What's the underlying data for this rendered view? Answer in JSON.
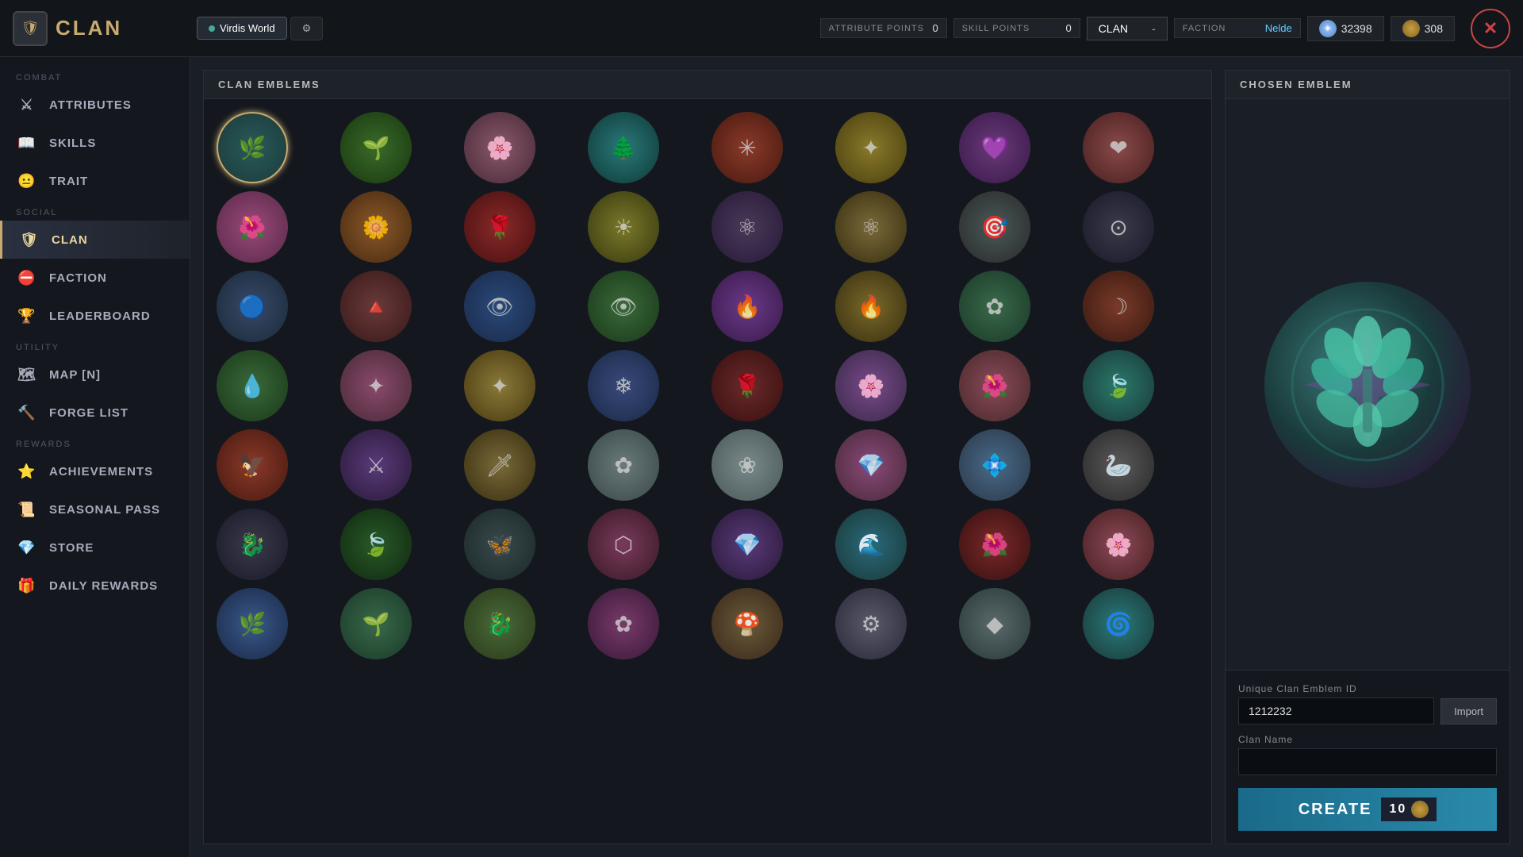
{
  "topbar": {
    "logo": "CLAN",
    "tabs": [
      {
        "label": "Virdis World",
        "active": true
      },
      {
        "label": "⚙",
        "active": false
      }
    ],
    "attribute_points_label": "ATTRIBUTE POINTS",
    "attribute_points_value": "0",
    "skill_points_label": "SKILL POINTS",
    "skill_points_value": "0",
    "clan_label": "CLAN",
    "clan_dash": "-",
    "faction_label": "FACTION",
    "faction_value": "Nelde",
    "currency1_value": "32398",
    "currency2_value": "308",
    "close_label": "✕"
  },
  "sidebar": {
    "section_combat": "COMBAT",
    "section_social": "SOCIAL",
    "section_utility": "UTILITY",
    "section_rewards": "REWARDS",
    "items": [
      {
        "id": "attributes",
        "label": "ATTRIBUTES",
        "icon": "⚔",
        "section": "combat"
      },
      {
        "id": "skills",
        "label": "SKILLS",
        "icon": "📖",
        "section": "combat"
      },
      {
        "id": "trait",
        "label": "TRAIT",
        "icon": "😐",
        "section": "combat"
      },
      {
        "id": "clan",
        "label": "CLAN",
        "icon": "🛡",
        "section": "social",
        "active": true
      },
      {
        "id": "faction",
        "label": "FACTION",
        "icon": "⛔",
        "section": "social"
      },
      {
        "id": "leaderboard",
        "label": "LEADERBOARD",
        "icon": "🏆",
        "section": "social"
      },
      {
        "id": "map",
        "label": "MAP [N]",
        "icon": "🗺",
        "section": "utility"
      },
      {
        "id": "forge",
        "label": "FORGE LIST",
        "icon": "🔨",
        "section": "utility"
      },
      {
        "id": "achievements",
        "label": "ACHIEVEMENTS",
        "icon": "⭐",
        "section": "rewards"
      },
      {
        "id": "seasonal",
        "label": "SEASONAL PASS",
        "icon": "📜",
        "section": "rewards"
      },
      {
        "id": "store",
        "label": "STORE",
        "icon": "💎",
        "section": "rewards"
      },
      {
        "id": "daily",
        "label": "DAILY REWARDS",
        "icon": "🎁",
        "section": "rewards"
      }
    ]
  },
  "emblems_panel": {
    "header": "CLAN EMBLEMS",
    "emblems": [
      {
        "id": 1,
        "class": "emb-teal-leaves",
        "symbol": "🌿"
      },
      {
        "id": 2,
        "class": "emb-green-wreath",
        "symbol": "🌱"
      },
      {
        "id": 3,
        "class": "emb-pink-tree",
        "symbol": "🌸"
      },
      {
        "id": 4,
        "class": "emb-teal-tree",
        "symbol": "🌲"
      },
      {
        "id": 5,
        "class": "emb-red-star",
        "symbol": "✳"
      },
      {
        "id": 6,
        "class": "emb-gold-star",
        "symbol": "✦"
      },
      {
        "id": 7,
        "class": "emb-purple-heart",
        "symbol": "💜"
      },
      {
        "id": 8,
        "class": "emb-rose-heart",
        "symbol": "❤"
      },
      {
        "id": 9,
        "class": "emb-pink-flower",
        "symbol": "🌺"
      },
      {
        "id": 10,
        "class": "emb-orange-flower",
        "symbol": "🌼"
      },
      {
        "id": 11,
        "class": "emb-red-flower",
        "symbol": "🌹"
      },
      {
        "id": 12,
        "class": "emb-yellow-burst",
        "symbol": "☀"
      },
      {
        "id": 13,
        "class": "emb-atom-dark",
        "symbol": "⚛"
      },
      {
        "id": 14,
        "class": "emb-atom-gold",
        "symbol": "⚛"
      },
      {
        "id": 15,
        "class": "emb-target-gray",
        "symbol": "🎯"
      },
      {
        "id": 16,
        "class": "emb-target-dark",
        "symbol": "⊙"
      },
      {
        "id": 17,
        "class": "emb-shield-blue",
        "symbol": "🔵"
      },
      {
        "id": 18,
        "class": "emb-shield-red",
        "symbol": "🔺"
      },
      {
        "id": 19,
        "class": "emb-eye-blue",
        "symbol": "👁"
      },
      {
        "id": 20,
        "class": "emb-eye-green",
        "symbol": "👁"
      },
      {
        "id": 21,
        "class": "emb-flame-purple",
        "symbol": "🔥"
      },
      {
        "id": 22,
        "class": "emb-flame-gold",
        "symbol": "🔥"
      },
      {
        "id": 23,
        "class": "emb-rosette-green",
        "symbol": "✿"
      },
      {
        "id": 24,
        "class": "emb-crescent-red",
        "symbol": "☽"
      },
      {
        "id": 25,
        "class": "emb-drop-green",
        "symbol": "💧"
      },
      {
        "id": 26,
        "class": "emb-star4-pink",
        "symbol": "✦"
      },
      {
        "id": 27,
        "class": "emb-star4-gold",
        "symbol": "✦"
      },
      {
        "id": 28,
        "class": "emb-burst-blue",
        "symbol": "❄"
      },
      {
        "id": 29,
        "class": "emb-rose-dark",
        "symbol": "🌹"
      },
      {
        "id": 30,
        "class": "emb-rose-purple",
        "symbol": "🌸"
      },
      {
        "id": 31,
        "class": "emb-rose-pink",
        "symbol": "🌺"
      },
      {
        "id": 32,
        "class": "emb-leaf-teal",
        "symbol": "🍃"
      },
      {
        "id": 33,
        "class": "emb-bird-red",
        "symbol": "🦅"
      },
      {
        "id": 34,
        "class": "emb-sword-purple",
        "symbol": "⚔"
      },
      {
        "id": 35,
        "class": "emb-sword-gold",
        "symbol": "🗡"
      },
      {
        "id": 36,
        "class": "emb-flower-white",
        "symbol": "✿"
      },
      {
        "id": 37,
        "class": "emb-flower-white2",
        "symbol": "❀"
      },
      {
        "id": 38,
        "class": "emb-gem-pink",
        "symbol": "💎"
      },
      {
        "id": 39,
        "class": "emb-gem-blue",
        "symbol": "💠"
      },
      {
        "id": 40,
        "class": "emb-bird-gray",
        "symbol": "🦢"
      },
      {
        "id": 41,
        "class": "emb-dragon-dark",
        "symbol": "🐉"
      },
      {
        "id": 42,
        "class": "emb-leaf-green",
        "symbol": "🍃"
      },
      {
        "id": 43,
        "class": "emb-wings-dark",
        "symbol": "🦋"
      },
      {
        "id": 44,
        "class": "emb-hex-pink",
        "symbol": "⬡"
      },
      {
        "id": 45,
        "class": "emb-gem-purple",
        "symbol": "💎"
      },
      {
        "id": 46,
        "class": "emb-teal-design",
        "symbol": "🌊"
      },
      {
        "id": 47,
        "class": "emb-red-design",
        "symbol": "🌺"
      },
      {
        "id": 48,
        "class": "emb-sakura-pink",
        "symbol": "🌸"
      },
      {
        "id": 49,
        "class": "emb-blue-leaf",
        "symbol": "🌿"
      },
      {
        "id": 50,
        "class": "emb-multi-green",
        "symbol": "🌱"
      },
      {
        "id": 51,
        "class": "emb-dragon2",
        "symbol": "🐉"
      },
      {
        "id": 52,
        "class": "emb-ornate-pink",
        "symbol": "✿"
      },
      {
        "id": 53,
        "class": "emb-mushroom",
        "symbol": "🍄"
      },
      {
        "id": 54,
        "class": "emb-mech-gray",
        "symbol": "⚙"
      },
      {
        "id": 55,
        "class": "emb-diamond-gray",
        "symbol": "◆"
      },
      {
        "id": 56,
        "class": "emb-teal-ornate",
        "symbol": "🌀"
      }
    ]
  },
  "right_panel": {
    "header": "CHOSEN EMBLEM",
    "emblem_id_label": "Unique Clan Emblem ID",
    "emblem_id_value": "1212232",
    "import_label": "Import",
    "clan_name_label": "Clan Name",
    "clan_name_placeholder": "",
    "create_label": "CREATE",
    "create_cost": "10"
  }
}
